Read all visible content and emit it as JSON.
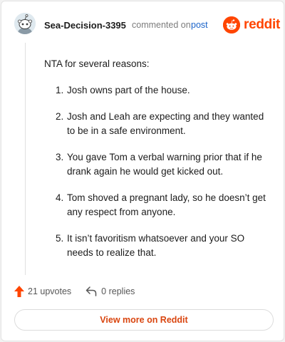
{
  "comment": {
    "username": "Sea-Decision-3395",
    "commented_text": "commented on",
    "post_link": "post",
    "intro": "NTA for several reasons:",
    "reasons": [
      {
        "num": "1.",
        "text": "Josh owns part of the house."
      },
      {
        "num": "2.",
        "text": "Josh and Leah are expecting and they wanted to be in a safe environment."
      },
      {
        "num": "3.",
        "text": "You gave Tom a verbal warning prior that if he drank again he would get kicked out."
      },
      {
        "num": "4.",
        "text": "Tom shoved a pregnant lady, so he doesn’t get any respect from anyone."
      },
      {
        "num": "5.",
        "text": "It isn’t favoritism whatsoever and your SO needs to realize that."
      }
    ]
  },
  "brand": {
    "wordmark": "reddit",
    "color": "#ff4500"
  },
  "actions": {
    "upvotes": "21 upvotes",
    "replies": "0 replies"
  },
  "footer": {
    "view_more": "View more on Reddit"
  },
  "colors": {
    "link": "#1a63c9",
    "upvote": "#ff4500",
    "cta": "#d9450f"
  }
}
